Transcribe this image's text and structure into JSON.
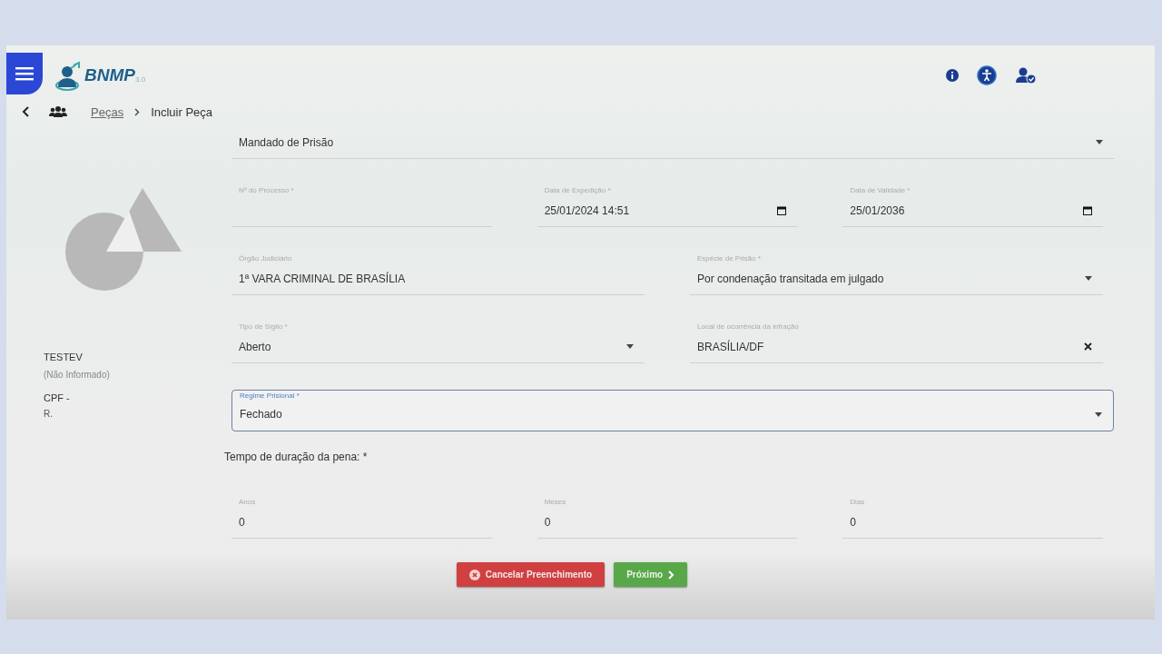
{
  "header": {
    "logo_title": "BNMP",
    "logo_version": "3.0"
  },
  "breadcrumb": [
    {
      "label": "Peças",
      "link": true
    },
    {
      "label": "Incluir Peça",
      "link": false
    }
  ],
  "person": {
    "name": "TESTEV",
    "note": "(Não Informado)",
    "cpf": "CPF -",
    "rg": "R."
  },
  "rows": [
    [
      {
        "kind": "select",
        "value": "Mandado de Prisão",
        "focused": false
      }
    ],
    [
      {
        "kind": "text",
        "label": "Nº do Processo *",
        "focused": false
      },
      {
        "kind": "date",
        "label": "Data de Expedição *",
        "value": "25/01/2024 14:51",
        "focused": false
      },
      {
        "kind": "date",
        "label": "Data de Validade *",
        "value": "25/01/2036",
        "focused": false
      }
    ],
    [
      {
        "kind": "text",
        "label": "Órgão Judiciário",
        "value": "1ª VARA CRIMINAL DE BRASÍLIA",
        "focused": false
      },
      {
        "kind": "select",
        "label": "Espécie de Prisão *",
        "value": "Por condenação transitada em julgado",
        "focused": false
      }
    ],
    [
      {
        "kind": "select",
        "label": "Tipo de Sigilo *",
        "value": "Aberto",
        "focused": false
      },
      {
        "kind": "clearable",
        "label": "Local de ocorrência da infração",
        "value": "BRASÍLIA/DF",
        "focused": false
      }
    ],
    [
      {
        "kind": "select",
        "label": "Regime Prisional *",
        "value": "Fechado",
        "focused": true
      }
    ]
  ],
  "section_label": "Tempo de duração da pena: *",
  "duration": [
    {
      "label": "Anos",
      "value": "0",
      "focused": false
    },
    {
      "label": "Meses",
      "value": "0",
      "focused": false
    },
    {
      "label": "Dias",
      "value": "0",
      "focused": false
    }
  ],
  "buttons": [
    {
      "kind": "cancel",
      "label": "Cancelar Preenchimento"
    },
    {
      "kind": "next",
      "label": "Próximo"
    }
  ]
}
